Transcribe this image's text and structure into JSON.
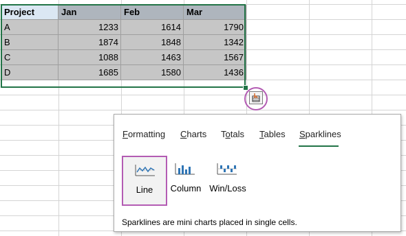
{
  "table": {
    "headers": [
      "Project",
      "Jan",
      "Feb",
      "Mar"
    ],
    "rows": [
      [
        "A",
        "1233",
        "1614",
        "1790"
      ],
      [
        "B",
        "1874",
        "1848",
        "1342"
      ],
      [
        "C",
        "1088",
        "1463",
        "1567"
      ],
      [
        "D",
        "1685",
        "1580",
        "1436"
      ]
    ]
  },
  "quick_analysis": {
    "tabs": [
      {
        "label": "Formatting",
        "mnemonic": "F",
        "rest": "ormatting"
      },
      {
        "label": "Charts",
        "mnemonic": "C",
        "rest": "harts"
      },
      {
        "label": "Totals",
        "mnemonic": "o",
        "pre": "T",
        "rest": "tals"
      },
      {
        "label": "Tables",
        "mnemonic": "T",
        "rest": "ables"
      },
      {
        "label": "Sparklines",
        "mnemonic": "S",
        "rest": "parklines",
        "active": true
      }
    ],
    "options": [
      {
        "label": "Line",
        "icon": "sparkline-line-icon",
        "selected": true
      },
      {
        "label": "Column",
        "icon": "sparkline-column-icon",
        "selected": false
      },
      {
        "label": "Win/Loss",
        "icon": "sparkline-winloss-icon",
        "selected": false
      }
    ],
    "description": "Sparklines are mini charts placed in single cells."
  },
  "colors": {
    "selection_border": "#217346",
    "highlight_ring": "#b35bb3",
    "icon_blue": "#2f75b5"
  }
}
